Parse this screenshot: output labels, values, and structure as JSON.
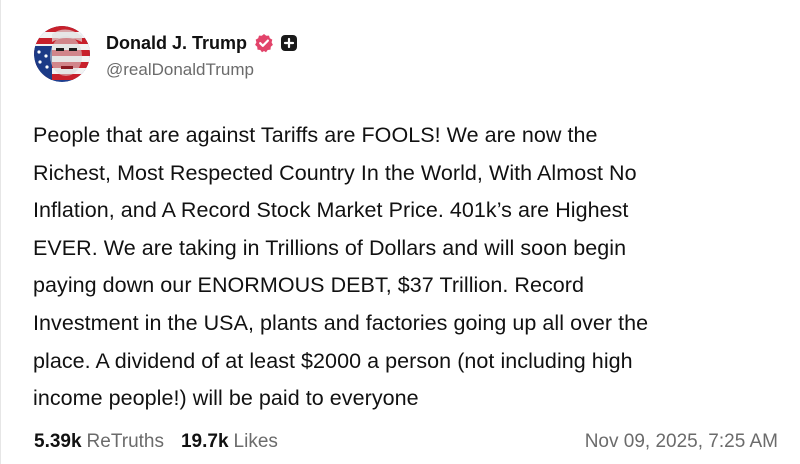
{
  "post": {
    "author": {
      "display_name": "Donald J. Trump",
      "handle": "@realDonaldTrump",
      "verified_icon": "verified-badge-icon",
      "verified_color": "#e2436a",
      "extra_icon": "plus-square-icon"
    },
    "body_lines": [
      "People that are against Tariffs are FOOLS! We are now the",
      "Richest, Most Respected Country In the World, With Almost No",
      "Inflation, and A Record Stock Market Price. 401k’s are Highest",
      "EVER. We are taking in Trillions of Dollars and will soon begin",
      "paying down our ENORMOUS DEBT, $37 Trillion. Record",
      "Investment in the USA, plants and factories going up all over the",
      "place. A dividend of at least $2000 a person (not including high",
      "income people!) will be paid to everyone"
    ],
    "stats": {
      "retruths_count": "5.39k",
      "retruths_label": "ReTruths",
      "likes_count": "19.7k",
      "likes_label": "Likes"
    },
    "timestamp": "Nov 09, 2025, 7:25 AM"
  },
  "colors": {
    "text_primary": "#111111",
    "text_secondary": "#6b6b6b",
    "background": "#ffffff"
  }
}
